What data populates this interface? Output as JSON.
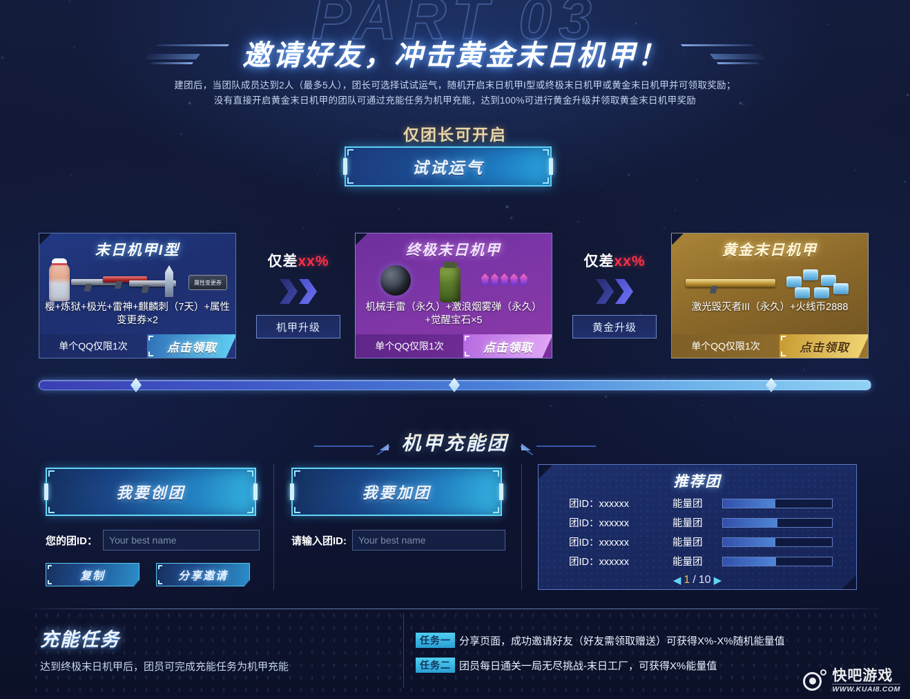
{
  "header": {
    "ghost_text": "PART 03",
    "title": "邀请好友，冲击黄金末日机甲！",
    "desc_line1": "建团后，当团队成员达到2人（最多5人），团长可选择试试运气，随机开启末日机甲I型或终极末日机甲或黄金末日机甲并可领取奖励；",
    "desc_line2": "没有直接开启黄金末日机甲的团队可通过充能任务为机甲充能，达到100%可进行黄金升级并领取黄金末日机甲奖励"
  },
  "lucky": {
    "leader_label": "仅团长可开启",
    "button_label": "试试运气"
  },
  "cards": [
    {
      "title": "末日机甲I型",
      "desc": "樱+炼狱+极光+雷神+麒麟刺（7天）+属性变更券×2",
      "limit": "单个QQ仅限1次",
      "claim": "点击领取",
      "coupon_label": "属性变更券"
    },
    {
      "title": "终极末日机甲",
      "desc": "机械手雷（永久）+激浪烟雾弹（永久）+觉醒宝石×5",
      "limit": "单个QQ仅限1次",
      "claim": "点击领取"
    },
    {
      "title": "黄金末日机甲",
      "desc": "激光毁灭者III（永久）+火线币2888",
      "limit": "单个QQ仅限1次",
      "claim": "点击领取"
    }
  ],
  "connectors": [
    {
      "prefix": "仅差",
      "value": "xx%",
      "button": "机甲升级"
    },
    {
      "prefix": "仅差",
      "value": "xx%",
      "button": "黄金升级"
    }
  ],
  "section": {
    "title": "机甲充能团"
  },
  "create_team": {
    "button": "我要创团",
    "field_label": "您的团ID：",
    "field_placeholder": "Your best name",
    "copy_button": "复制",
    "share_button": "分享邀请"
  },
  "join_team": {
    "button": "我要加团",
    "field_label": "请输入团ID:",
    "field_placeholder": "Your best name"
  },
  "recommend": {
    "title": "推荐团",
    "rows": [
      {
        "id": "团ID：xxxxxx",
        "tag": "能量团",
        "progress": 48
      },
      {
        "id": "团ID：xxxxxx",
        "tag": "能量团",
        "progress": 50
      },
      {
        "id": "团ID：xxxxxx",
        "tag": "能量团",
        "progress": 48
      },
      {
        "id": "团ID：xxxxxx",
        "tag": "能量团",
        "progress": 49
      }
    ],
    "prev": "◀",
    "current_page": "1",
    "separator": "/",
    "total_pages": "10",
    "next": "▶"
  },
  "tasks": {
    "title": "充能任务",
    "subtitle": "达到终极末日机甲后，团员可完成充能任务为机甲充能",
    "items": [
      {
        "badge": "任务一",
        "text": "分享页面，成功邀请好友（好友需领取赠送）可获得X%-X%随机能量值"
      },
      {
        "badge": "任务二",
        "text": "团员每日通关一局无尽挑战-末日工厂，可获得X%能量值"
      }
    ]
  },
  "watermark": {
    "name": "快吧游戏",
    "url": "WWW.KUAI8.COM"
  },
  "colors": {
    "accent_cyan": "#5fd0f5",
    "gold": "#e8d6a8",
    "danger_red": "#ff2f46",
    "card1": "#223a84",
    "card2": "#7b35a6",
    "card3": "#a98438"
  }
}
